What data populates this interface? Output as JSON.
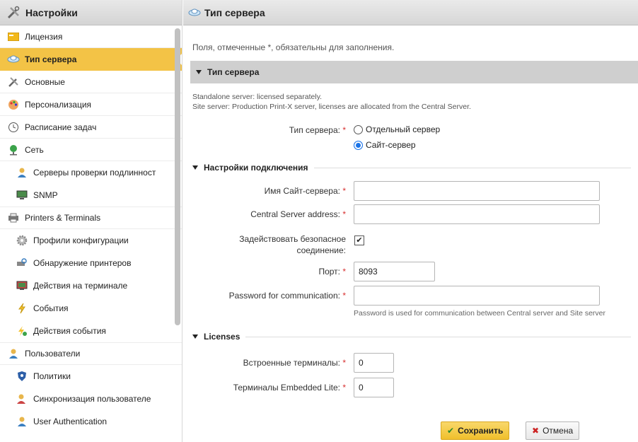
{
  "sidebar": {
    "title": "Настройки",
    "items": [
      {
        "label": "Лицензия",
        "icon": "license-icon"
      },
      {
        "label": "Тип сервера",
        "icon": "server-type-icon",
        "active": true
      },
      {
        "label": "Основные",
        "icon": "general-tools-icon"
      },
      {
        "label": "Персонализация",
        "icon": "palette-icon"
      },
      {
        "label": "Расписание задач",
        "icon": "clock-icon"
      },
      {
        "label": "Сеть",
        "icon": "network-globe-icon"
      },
      {
        "label": "Серверы проверки подлинност",
        "icon": "auth-server-icon",
        "sub": true
      },
      {
        "label": "SNMP",
        "icon": "monitor-icon",
        "sub": true
      },
      {
        "label": "Printers & Terminals",
        "icon": "printer-icon"
      },
      {
        "label": "Профили конфигурации",
        "icon": "gear-icon",
        "sub": true
      },
      {
        "label": "Обнаружение принтеров",
        "icon": "printer-search-icon",
        "sub": true
      },
      {
        "label": "Действия на терминале",
        "icon": "terminal-icon",
        "sub": true
      },
      {
        "label": "События",
        "icon": "lightning-icon",
        "sub": true
      },
      {
        "label": "Действия события",
        "icon": "event-actions-icon",
        "sub": true
      },
      {
        "label": "Пользователи",
        "icon": "user-icon"
      },
      {
        "label": "Политики",
        "icon": "shield-icon",
        "sub": true
      },
      {
        "label": "Синхронизация пользователе",
        "icon": "user-sync-icon",
        "sub": true
      },
      {
        "label": "User Authentication",
        "icon": "user-auth-icon",
        "sub": true
      }
    ]
  },
  "main": {
    "title": "Тип сервера",
    "required_note": "Поля, отмеченные *, обязательны для заполнения.",
    "section_title": "Тип сервера",
    "desc_line1": "Standalone server: licensed separately.",
    "desc_line2": "Site server: Production Print-X server, licenses are allocated from the Central Server.",
    "server_type_label": "Тип сервера:",
    "radio_standalone": "Отдельный сервер",
    "radio_site": "Сайт-сервер",
    "selected": "Сайт-сервер",
    "connection_title": "Настройки подключения",
    "site_server_name_label": "Имя Сайт-сервера:",
    "site_server_name_value": "",
    "central_address_label": "Central Server address:",
    "central_address_value": "",
    "secure_label_1": "Задействовать безопасное",
    "secure_label_2": "соединение:",
    "secure_checked": "✔",
    "port_label": "Порт:",
    "port_value": "8093",
    "password_label": "Password for communication:",
    "password_value": "",
    "password_hint": "Password is used for communication between Central server and Site server",
    "licenses_title": "Licenses",
    "embedded_label": "Встроенные терминалы:",
    "embedded_value": "0",
    "embedded_lite_label": "Терминалы Embedded Lite:",
    "embedded_lite_value": "0",
    "save_label": "Сохранить",
    "cancel_label": "Отмена",
    "required_mark": "*"
  },
  "colors": {
    "active_item": "#f3c346",
    "section_bar": "#cfcfcf",
    "required": "#d83030",
    "save_button": "#f0bf2c"
  }
}
